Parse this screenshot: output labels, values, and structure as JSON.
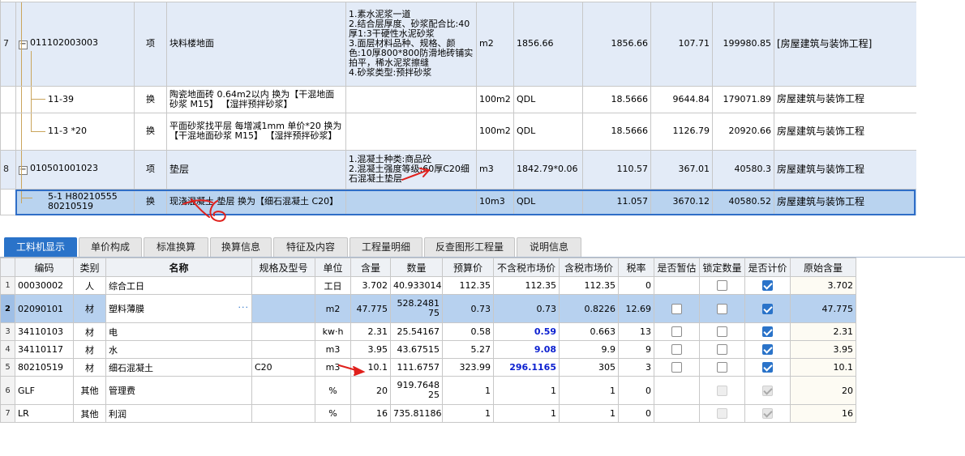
{
  "top_grid": {
    "rows": [
      {
        "index": "7",
        "code": "011102003003",
        "type": "项",
        "name": "块料楼地面",
        "features": "1.素水泥浆一道\n2.结合层厚度、砂浆配合比:40厚1:3干硬性水泥砂浆\n3.面层材料品种、规格、颜色:10厚800*800防滑地砖铺实拍平，稀水泥浆擦缝\n4.砂浆类型:预拌砂浆",
        "unit": "m2",
        "qty_expr": "1856.66",
        "qty": "1856.66",
        "price": "107.71",
        "total": "199980.85",
        "major": "[房屋建筑与装饰工程]"
      },
      {
        "index": "",
        "code": "11-39",
        "type": "换",
        "name": "陶瓷地面砖 0.64m2以内  换为【干混地面砂浆 M15】  【湿拌预拌砂浆】",
        "features": "",
        "unit": "100m2",
        "qty_expr": "QDL",
        "qty": "18.5666",
        "price": "9644.84",
        "total": "179071.89",
        "major": "房屋建筑与装饰工程"
      },
      {
        "index": "",
        "code": "11-3 *20",
        "type": "换",
        "name": "平面砂浆找平层 每增减1mm  单价*20  换为【干混地面砂浆 M15】  【湿拌预拌砂浆】",
        "features": "",
        "unit": "100m2",
        "qty_expr": "QDL",
        "qty": "18.5666",
        "price": "1126.79",
        "total": "20920.66",
        "major": "房屋建筑与装饰工程"
      },
      {
        "index": "8",
        "code": "010501001023",
        "type": "项",
        "name": "垫层",
        "features": "1.混凝土种类:商品砼\n2.混凝土强度等级:60厚C20细石混凝土垫层",
        "unit": "m3",
        "qty_expr": "1842.79*0.06",
        "qty": "110.57",
        "price": "367.01",
        "total": "40580.3",
        "major": "房屋建筑与装饰工程"
      },
      {
        "index": "",
        "code": "5-1 H80210555 80210519",
        "type": "换",
        "name": "现浇混凝土 垫层  换为【细石混凝土 C20】",
        "features": "",
        "unit": "10m3",
        "qty_expr": "QDL",
        "qty": "11.057",
        "price": "3670.12",
        "total": "40580.52",
        "major": "房屋建筑与装饰工程"
      }
    ]
  },
  "tabs": [
    {
      "label": "工料机显示",
      "active": true
    },
    {
      "label": "单价构成",
      "active": false
    },
    {
      "label": "标准换算",
      "active": false
    },
    {
      "label": "换算信息",
      "active": false
    },
    {
      "label": "特征及内容",
      "active": false
    },
    {
      "label": "工程量明细",
      "active": false
    },
    {
      "label": "反查图形工程量",
      "active": false
    },
    {
      "label": "说明信息",
      "active": false
    }
  ],
  "bottom_grid": {
    "headers": [
      "",
      "编码",
      "类别",
      "名称",
      "规格及型号",
      "单位",
      "含量",
      "数量",
      "预算价",
      "不含税市场价",
      "含税市场价",
      "税率",
      "是否暂估",
      "锁定数量",
      "是否计价",
      "原始含量"
    ],
    "rows": [
      {
        "n": "1",
        "code": "00030002",
        "cat": "人",
        "name": "综合工日",
        "spec": "",
        "unit": "工日",
        "content": "3.702",
        "qty": "40.933014",
        "budget": "112.35",
        "mkt": "112.35",
        "mkt_tax": "112.35",
        "rate": "0",
        "est": null,
        "lock": false,
        "price_on": true,
        "orig": "3.702"
      },
      {
        "n": "2",
        "code": "02090101",
        "cat": "材",
        "name": "塑料薄膜",
        "spec": "",
        "unit": "m2",
        "content": "47.775",
        "qty": "528.248175",
        "budget": "0.73",
        "mkt": "0.73",
        "mkt_tax": "0.8226",
        "rate": "12.69",
        "est": false,
        "lock": false,
        "price_on": true,
        "orig": "47.775"
      },
      {
        "n": "3",
        "code": "34110103",
        "cat": "材",
        "name": "电",
        "spec": "",
        "unit": "kw·h",
        "content": "2.31",
        "qty": "25.54167",
        "budget": "0.58",
        "mkt": "0.59",
        "mkt_tax": "0.663",
        "rate": "13",
        "est": false,
        "lock": false,
        "price_on": true,
        "orig": "2.31"
      },
      {
        "n": "4",
        "code": "34110117",
        "cat": "材",
        "name": "水",
        "spec": "",
        "unit": "m3",
        "content": "3.95",
        "qty": "43.67515",
        "budget": "5.27",
        "mkt": "9.08",
        "mkt_tax": "9.9",
        "rate": "9",
        "est": false,
        "lock": false,
        "price_on": true,
        "orig": "3.95"
      },
      {
        "n": "5",
        "code": "80210519",
        "cat": "材",
        "name": "细石混凝土",
        "spec": "C20",
        "unit": "m3",
        "content": "10.1",
        "qty": "111.6757",
        "budget": "323.99",
        "mkt": "296.1165",
        "mkt_tax": "305",
        "rate": "3",
        "est": false,
        "lock": false,
        "price_on": true,
        "orig": "10.1"
      },
      {
        "n": "6",
        "code": "GLF",
        "cat": "其他",
        "name": "管理费",
        "spec": "",
        "unit": "%",
        "content": "20",
        "qty": "919.764825",
        "budget": "1",
        "mkt": "1",
        "mkt_tax": "1",
        "rate": "0",
        "est": null,
        "lock": null,
        "price_on": "dis",
        "orig": "20"
      },
      {
        "n": "7",
        "code": "LR",
        "cat": "其他",
        "name": "利润",
        "spec": "",
        "unit": "%",
        "content": "16",
        "qty": "735.81186",
        "budget": "1",
        "mkt": "1",
        "mkt_tax": "1",
        "rate": "0",
        "est": null,
        "lock": null,
        "price_on": "dis",
        "orig": "16"
      }
    ]
  },
  "colors": {
    "accent": "#2a73c9",
    "selection": "#b7d1ef",
    "annotation": "#e0201c",
    "highlight_value": "#0b1fd0"
  }
}
